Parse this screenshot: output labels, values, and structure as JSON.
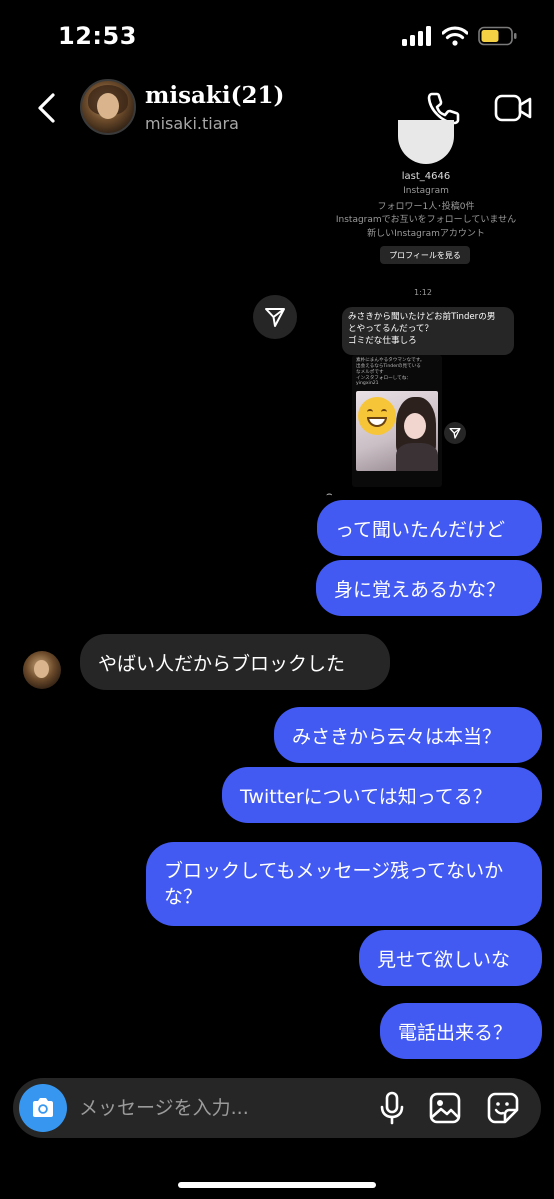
{
  "status_bar": {
    "time": "12:53"
  },
  "header": {
    "display_name": "misaki(21)",
    "username": "misaki.tiara"
  },
  "profile_card": {
    "name": "last_4646",
    "platform": "Instagram",
    "stats": "フォロワー1人･投稿0件",
    "mutual": "Instagramでお互いをフォローしていません",
    "new_account": "新しいInstagramアカウント",
    "view_profile_label": "プロフィールを見る"
  },
  "timestamp": "1:12",
  "forwarded_message": {
    "line1": "みさきから聞いたけどお前Tinderの男",
    "line2": "とやってるんだって？",
    "line3": "ゴミだな仕事しろ"
  },
  "shared_post": {
    "line1": "素朴にまんやるタウマンなです。",
    "line2": "出会えるならTinderの見ている",
    "line3": "なメルポです",
    "line4": "インスタフォローしてね：",
    "line5": "yingxin21"
  },
  "messages": [
    {
      "side": "sent",
      "text": "って聞いたんだけど"
    },
    {
      "side": "sent",
      "text": "身に覚えあるかな？"
    },
    {
      "side": "received",
      "text": "やばい人だからブロックした"
    },
    {
      "side": "sent",
      "text": "みさきから云々は本当？"
    },
    {
      "side": "sent",
      "text": "Twitterについては知ってる？"
    },
    {
      "side": "sent",
      "text": "ブロックしてもメッセージ残ってないかな？"
    },
    {
      "side": "sent",
      "text": "見せて欲しいな"
    },
    {
      "side": "sent",
      "text": "電話出来る？"
    }
  ],
  "composer": {
    "placeholder": "メッセージを入力..."
  },
  "colors": {
    "sent_bubble": "#4259f2",
    "received_bubble": "#262626",
    "camera_button": "#3797f0",
    "background": "#000000"
  }
}
